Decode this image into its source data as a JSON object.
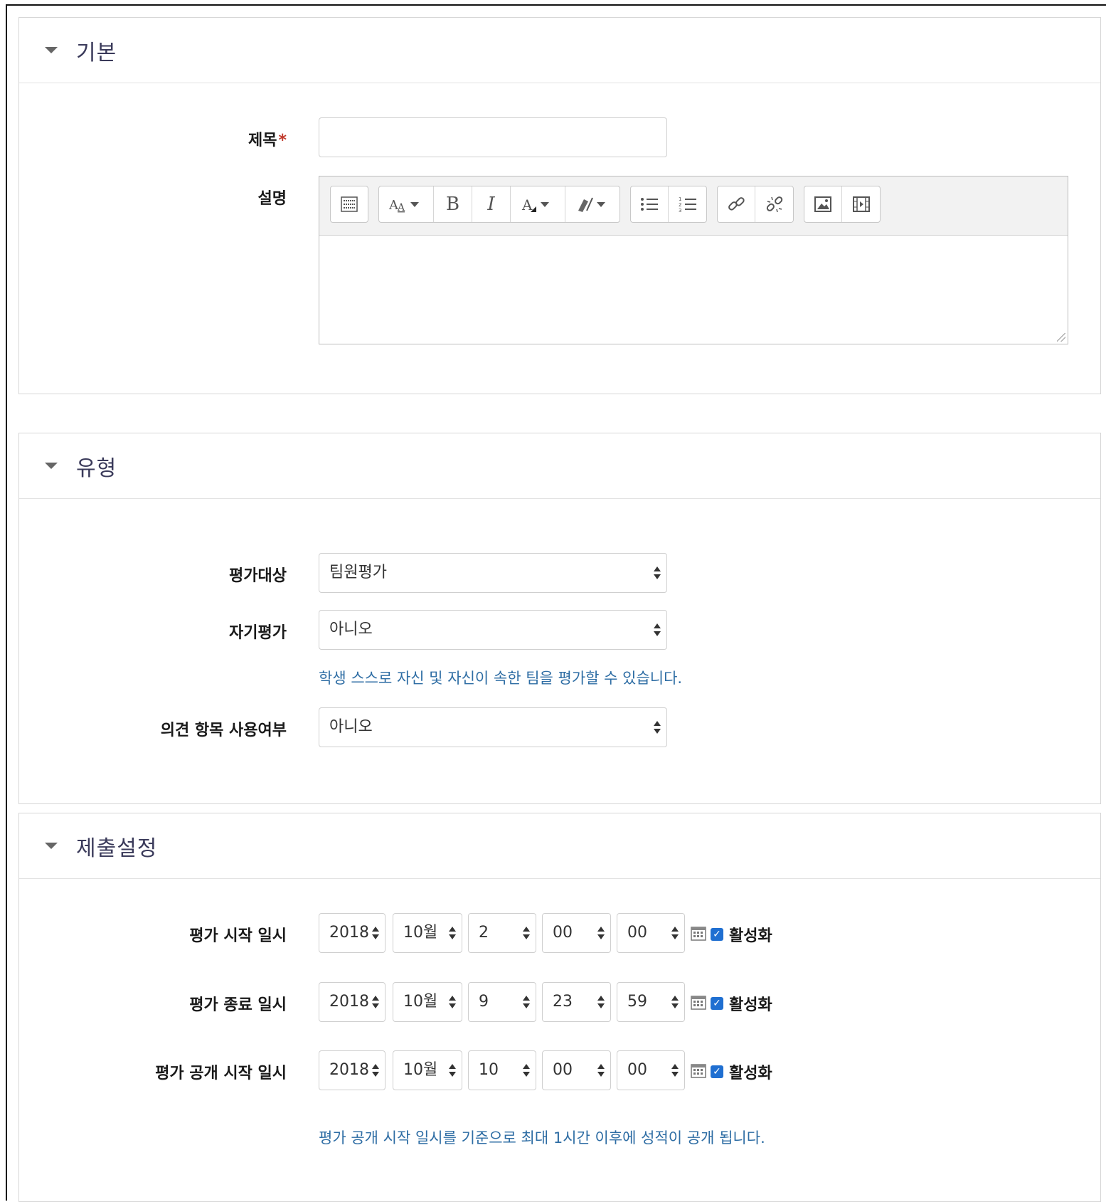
{
  "sections": {
    "basic": {
      "title": "기본",
      "title_field_label": "제목",
      "required_mark": "*",
      "title_value": "",
      "description_label": "설명"
    },
    "type": {
      "title": "유형",
      "target_label": "평가대상",
      "target_value": "팀원평가",
      "self_eval_label": "자기평가",
      "self_eval_value": "아니오",
      "self_eval_help": "학생 스스로 자신 및 자신이 속한 팀을 평가할 수 있습니다.",
      "comment_label": "의견 항목 사용여부",
      "comment_value": "아니오"
    },
    "submission": {
      "title": "제출설정",
      "start": {
        "label": "평가 시작 일시",
        "year": "2018",
        "month": "10월",
        "day": "2",
        "hour": "00",
        "minute": "00",
        "enable": "활성화",
        "enabled": true
      },
      "end": {
        "label": "평가 종료 일시",
        "year": "2018",
        "month": "10월",
        "day": "9",
        "hour": "23",
        "minute": "59",
        "enable": "활성화",
        "enabled": true
      },
      "publish": {
        "label": "평가 공개 시작 일시",
        "year": "2018",
        "month": "10월",
        "day": "10",
        "hour": "00",
        "minute": "00",
        "enable": "활성화",
        "enabled": true
      },
      "publish_help": "평가 공개 시작 일시를 기준으로 최대 1시간 이후에 성적이 공개 됩니다."
    }
  },
  "editor_toolbar": {
    "buttons": [
      "toolbar-toggle-icon",
      "font-size-icon",
      "bold-icon",
      "italic-icon",
      "font-color-icon",
      "highlight-icon",
      "bullet-list-icon",
      "numbered-list-icon",
      "link-icon",
      "unlink-icon",
      "image-icon",
      "media-icon"
    ],
    "bold_glyph": "B",
    "italic_glyph": "I"
  },
  "colors": {
    "help_text": "#2e6da4",
    "required": "#c0392b",
    "checkbox": "#1f6fd1"
  }
}
